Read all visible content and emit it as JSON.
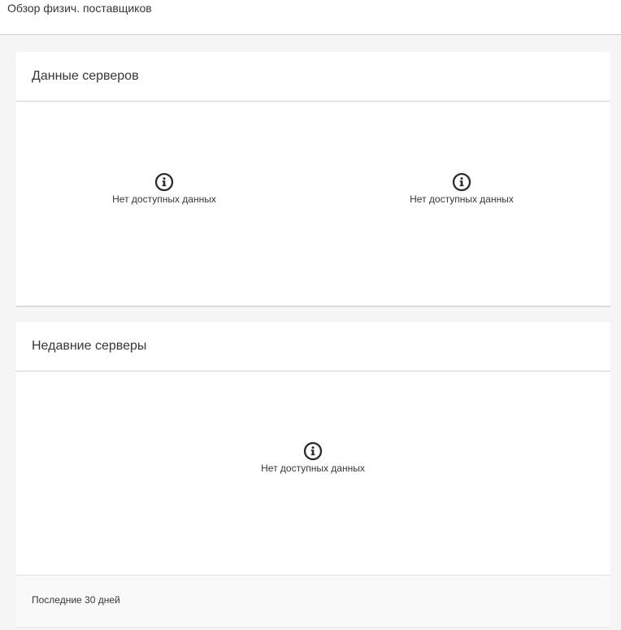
{
  "header": {
    "title": "Обзор физич. поставщиков"
  },
  "cards": {
    "server_data": {
      "title": "Данные серверов",
      "widgets": [
        {
          "icon": "info-icon",
          "message": "Нет доступных данных"
        },
        {
          "icon": "info-icon",
          "message": "Нет доступных данных"
        }
      ]
    },
    "recent_servers": {
      "title": "Недавние серверы",
      "widgets": [
        {
          "icon": "info-icon",
          "message": "Нет доступных данных"
        }
      ],
      "footer": "Последние 30 дней"
    }
  },
  "colors": {
    "background": "#f5f5f5",
    "card": "#ffffff",
    "text": "#363636",
    "border": "#d1d1d1"
  }
}
